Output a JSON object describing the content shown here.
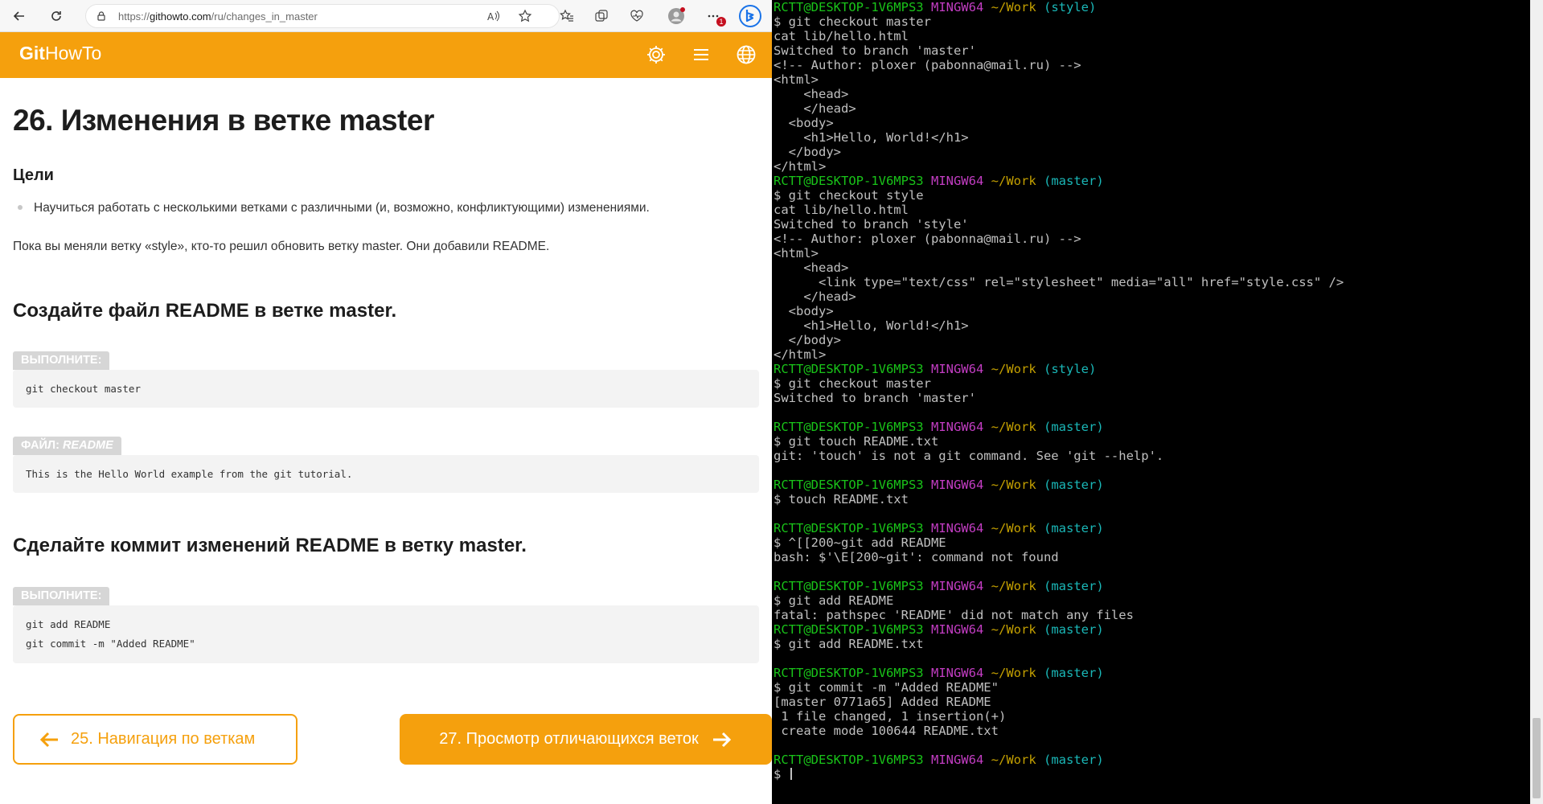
{
  "browser": {
    "url": {
      "scheme": "https://",
      "host": "githowto.com",
      "path": "/ru/changes_in_master"
    },
    "icons": {
      "back": "back-arrow-icon",
      "refresh": "refresh-icon",
      "lock": "lock-icon",
      "read_aloud": "read-aloud-icon",
      "favorite": "star-icon",
      "favorites": "favorites-icon",
      "collections": "collections-icon",
      "health": "browser-essentials-icon",
      "profile": "profile-icon",
      "more": "more-icon",
      "bing": "bing-copilot-icon"
    },
    "notification_badge": "1"
  },
  "site": {
    "logo_bold": "Git",
    "logo_light": "HowTo",
    "accent_color": "#f5a00d",
    "header_icons": [
      "gear-icon",
      "menu-icon",
      "globe-icon"
    ]
  },
  "page": {
    "title": "26. Изменения в ветке master",
    "goals_title": "Цели",
    "goal_item": "Научиться работать с несколькими ветками с различными (и, возможно, конфликтующими) изменениями.",
    "intro": "Пока вы меняли ветку «style», кто-то решил обновить ветку master. Они добавили README.",
    "section1_title": "Создайте файл README в ветке master.",
    "run_tag_1": "ВЫПОЛНИТЕ:",
    "code_run_1": [
      "git checkout master"
    ],
    "file_tag_prefix": "ФАЙЛ:",
    "file_tag_name": "README",
    "code_file": [
      "This is the Hello World example from the git tutorial."
    ],
    "section2_title": "Сделайте коммит изменений README в ветку master.",
    "run_tag_2": "ВЫПОЛНИТЕ:",
    "code_run_2": [
      "git add README",
      "git commit -m \"Added README\""
    ],
    "prev_link": "25. Навигация по веткам",
    "next_link": "27. Просмотр отличающихся веток"
  },
  "terminal": {
    "lines": [
      {
        "t": "prompt",
        "user": "RCTT@DESKTOP-1V6MPS3",
        "host": "MINGW64",
        "path": "~/Work",
        "branch": "(style)"
      },
      {
        "t": "text",
        "v": "$ git checkout master"
      },
      {
        "t": "text",
        "v": "cat lib/hello.html"
      },
      {
        "t": "text",
        "v": "Switched to branch 'master'"
      },
      {
        "t": "text",
        "v": "<!-- Author: ploxer (pabonna@mail.ru) -->"
      },
      {
        "t": "text",
        "v": "<html>"
      },
      {
        "t": "text",
        "v": "    <head>"
      },
      {
        "t": "text",
        "v": "    </head>"
      },
      {
        "t": "text",
        "v": "  <body>"
      },
      {
        "t": "text",
        "v": "    <h1>Hello, World!</h1>"
      },
      {
        "t": "text",
        "v": "  </body>"
      },
      {
        "t": "text",
        "v": "</html>"
      },
      {
        "t": "prompt",
        "user": "RCTT@DESKTOP-1V6MPS3",
        "host": "MINGW64",
        "path": "~/Work",
        "branch": "(master)"
      },
      {
        "t": "text",
        "v": "$ git checkout style"
      },
      {
        "t": "text",
        "v": "cat lib/hello.html"
      },
      {
        "t": "text",
        "v": "Switched to branch 'style'"
      },
      {
        "t": "text",
        "v": "<!-- Author: ploxer (pabonna@mail.ru) -->"
      },
      {
        "t": "text",
        "v": "<html>"
      },
      {
        "t": "text",
        "v": "    <head>"
      },
      {
        "t": "text",
        "v": "      <link type=\"text/css\" rel=\"stylesheet\" media=\"all\" href=\"style.css\" />"
      },
      {
        "t": "text",
        "v": "    </head>"
      },
      {
        "t": "text",
        "v": "  <body>"
      },
      {
        "t": "text",
        "v": "    <h1>Hello, World!</h1>"
      },
      {
        "t": "text",
        "v": "  </body>"
      },
      {
        "t": "text",
        "v": "</html>"
      },
      {
        "t": "prompt",
        "user": "RCTT@DESKTOP-1V6MPS3",
        "host": "MINGW64",
        "path": "~/Work",
        "branch": "(style)"
      },
      {
        "t": "text",
        "v": "$ git checkout master"
      },
      {
        "t": "text",
        "v": "Switched to branch 'master'"
      },
      {
        "t": "text",
        "v": ""
      },
      {
        "t": "prompt",
        "user": "RCTT@DESKTOP-1V6MPS3",
        "host": "MINGW64",
        "path": "~/Work",
        "branch": "(master)"
      },
      {
        "t": "text",
        "v": "$ git touch README.txt"
      },
      {
        "t": "text",
        "v": "git: 'touch' is not a git command. See 'git --help'."
      },
      {
        "t": "text",
        "v": ""
      },
      {
        "t": "prompt",
        "user": "RCTT@DESKTOP-1V6MPS3",
        "host": "MINGW64",
        "path": "~/Work",
        "branch": "(master)"
      },
      {
        "t": "text",
        "v": "$ touch README.txt"
      },
      {
        "t": "text",
        "v": ""
      },
      {
        "t": "prompt",
        "user": "RCTT@DESKTOP-1V6MPS3",
        "host": "MINGW64",
        "path": "~/Work",
        "branch": "(master)"
      },
      {
        "t": "text",
        "v": "$ ^[[200~git add README"
      },
      {
        "t": "text",
        "v": "bash: $'\\E[200~git': command not found"
      },
      {
        "t": "text",
        "v": ""
      },
      {
        "t": "prompt",
        "user": "RCTT@DESKTOP-1V6MPS3",
        "host": "MINGW64",
        "path": "~/Work",
        "branch": "(master)"
      },
      {
        "t": "text",
        "v": "$ git add README"
      },
      {
        "t": "text",
        "v": "fatal: pathspec 'README' did not match any files"
      },
      {
        "t": "prompt",
        "user": "RCTT@DESKTOP-1V6MPS3",
        "host": "MINGW64",
        "path": "~/Work",
        "branch": "(master)"
      },
      {
        "t": "text",
        "v": "$ git add README.txt"
      },
      {
        "t": "text",
        "v": ""
      },
      {
        "t": "prompt",
        "user": "RCTT@DESKTOP-1V6MPS3",
        "host": "MINGW64",
        "path": "~/Work",
        "branch": "(master)"
      },
      {
        "t": "text",
        "v": "$ git commit -m \"Added README\""
      },
      {
        "t": "text",
        "v": "[master 0771a65] Added README"
      },
      {
        "t": "text",
        "v": " 1 file changed, 1 insertion(+)"
      },
      {
        "t": "text",
        "v": " create mode 100644 README.txt"
      },
      {
        "t": "text",
        "v": ""
      },
      {
        "t": "prompt",
        "user": "RCTT@DESKTOP-1V6MPS3",
        "host": "MINGW64",
        "path": "~/Work",
        "branch": "(master)"
      },
      {
        "t": "input",
        "v": "$ "
      }
    ],
    "colors": {
      "background": "#000000",
      "text": "#c0c0c0",
      "user": "#19c419",
      "host": "#c33dc3",
      "path": "#c4a000",
      "branch": "#1ab7b7"
    }
  }
}
